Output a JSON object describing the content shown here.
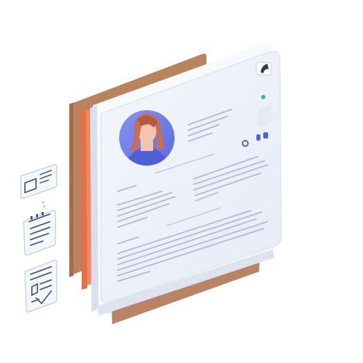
{
  "palette": {
    "background": "#ffffff",
    "back_panel": "#b9835e",
    "back_panel_edge": "#a46d4b",
    "orange_panel": "#f3875e",
    "orange_panel_edge": "#e0714a",
    "card_face": "#eef1f9",
    "card_edge": "#d9dfee",
    "card_frame": "#f8f9fd",
    "stack_pink": "#d8b2aa",
    "stack_brown": "#b98466",
    "text_lines": "#b6bfd7",
    "avatar_bg": "#6e80ea",
    "avatar_hair": "#c86d56",
    "avatar_skin": "#f6c4ad",
    "avatar_shirt": "#4f5fd6",
    "accent_teal": "#2ab7a8",
    "accent_blue": "#4a67d6",
    "icon_line": "#4a5b7a",
    "icon_card": "#f4f7fb"
  },
  "icons": {
    "main_card": "resume-document",
    "avatar": "woman-avatar",
    "corner_badge": "corner-badge-icon",
    "status_dot": "status-dot",
    "side_icon_1": "message-card-icon",
    "side_icon_2": "notepad-icon",
    "side_icon_3": "document-list-icon"
  }
}
